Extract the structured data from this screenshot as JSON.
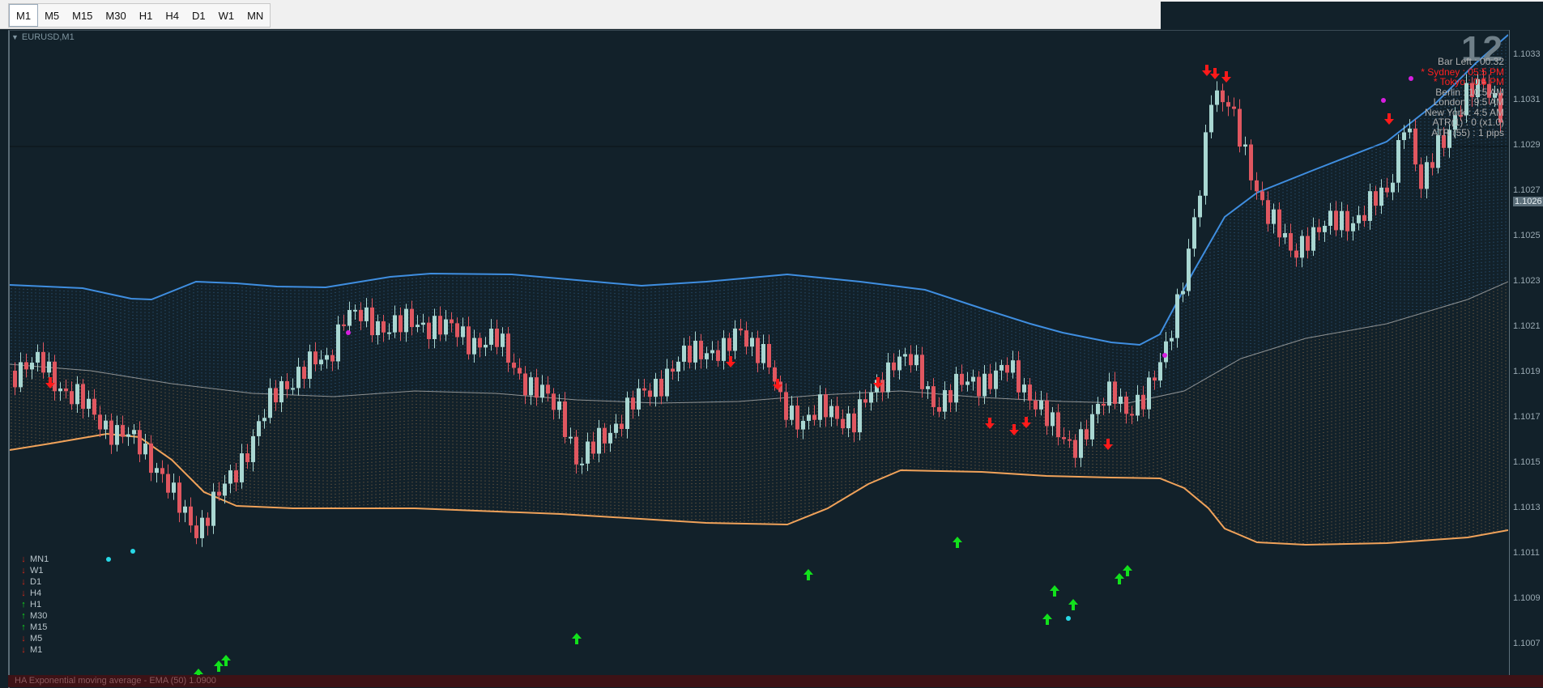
{
  "toolbar": {
    "timeframes": [
      "M1",
      "M5",
      "M15",
      "M30",
      "H1",
      "H4",
      "D1",
      "W1",
      "MN"
    ],
    "active": "M1"
  },
  "chart": {
    "symbol_label": "EURUSD,M1",
    "countdown_big": "12",
    "bottom_label": "HA Exponential moving average - EMA (50) 1.0900",
    "price_labels": [
      "1.1033",
      "1.1031",
      "1.1029",
      "1.1027",
      "1.1026",
      "1.1025",
      "1.1023",
      "1.1021",
      "1.1019",
      "1.1017",
      "1.1015",
      "1.1013",
      "1.1011",
      "1.1009",
      "1.1007"
    ],
    "current_price_label": "1.1026"
  },
  "info_panel": {
    "rows": [
      {
        "text": "Bar Left : 00:32",
        "color": "#b0b0b0"
      },
      {
        "text": "* Sydney : 05:5 PM",
        "color": "#ff2020"
      },
      {
        "text": "* Tokyo : 0:5 PM",
        "color": "#ff2020"
      },
      {
        "text": "Berlin : 10:5 AM",
        "color": "#b0b0b0"
      },
      {
        "text": "London : 9:5 AM",
        "color": "#b0b0b0"
      },
      {
        "text": "New York : 4:5 AM",
        "color": "#b0b0b0"
      },
      {
        "text": "ATR(1) : 0 (x1.0)",
        "color": "#b0b0b0"
      },
      {
        "text": "ATR (55) : 1 pips",
        "color": "#b0b0b0"
      }
    ]
  },
  "tf_panel": [
    {
      "label": "MN1",
      "dir": "down"
    },
    {
      "label": "W1",
      "dir": "down"
    },
    {
      "label": "D1",
      "dir": "down"
    },
    {
      "label": "H4",
      "dir": "down"
    },
    {
      "label": "H1",
      "dir": "up"
    },
    {
      "label": "M30",
      "dir": "up"
    },
    {
      "label": "M15",
      "dir": "up"
    },
    {
      "label": "M5",
      "dir": "down"
    },
    {
      "label": "M1",
      "dir": "down"
    }
  ],
  "colors": {
    "bull": "#a9d7d2",
    "bear": "#e05760",
    "upper_band": "#3f8ee0",
    "lower_band": "#f0a25a",
    "mid_line": "#8a8f92",
    "up_arrow": "#12e01c",
    "down_arrow": "#ff1a1a"
  }
}
